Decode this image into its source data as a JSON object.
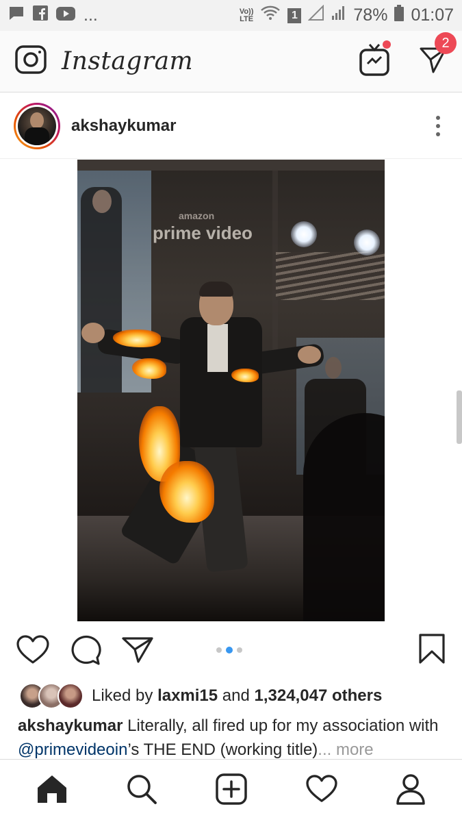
{
  "status_bar": {
    "volte_top": "Vo))",
    "volte_bottom": "LTE",
    "sim_slot": "1",
    "battery": "78%",
    "time": "01:07",
    "notif_more": "..."
  },
  "header": {
    "brand": "Instagram",
    "direct_badge": "2"
  },
  "post": {
    "username": "akshaykumar",
    "image_text": {
      "amazon": "amazon",
      "prime_video": "prime video"
    },
    "carousel": {
      "count": 3,
      "active_index": 1
    },
    "likes": {
      "prefix": "Liked by ",
      "liker": "laxmi15",
      "middle": " and ",
      "count": "1,324,047 others"
    },
    "caption": {
      "user": "akshaykumar",
      "text1": " Literally, all fired up for my association with ",
      "mention": "@primevideoin",
      "text2": "’s THE END (working title)",
      "ellipsis": "... ",
      "more": "more"
    }
  },
  "colors": {
    "badge": "#ed4956",
    "active_dot": "#3897f0",
    "mention": "#003569"
  },
  "icons": {
    "camera": "camera-icon",
    "igtv": "igtv-icon",
    "direct": "paper-plane-icon",
    "like": "heart-icon",
    "comment": "comment-icon",
    "share": "share-icon",
    "save": "bookmark-icon",
    "home": "home-icon",
    "search": "search-icon",
    "add": "add-post-icon",
    "activity": "heart-outline-icon",
    "profile": "profile-icon"
  }
}
